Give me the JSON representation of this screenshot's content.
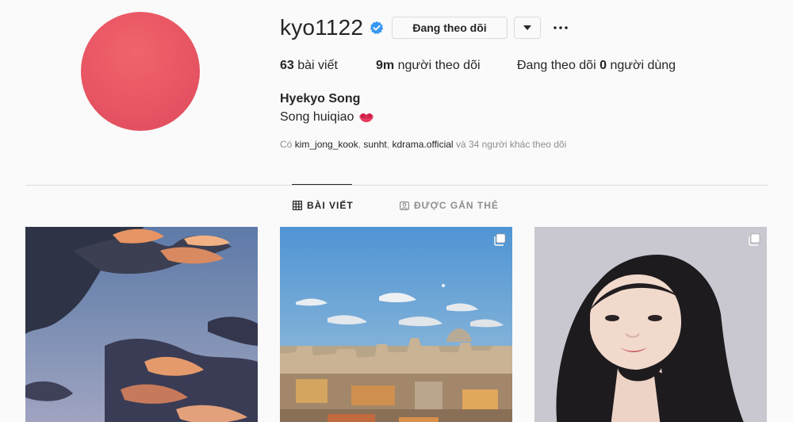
{
  "profile": {
    "username": "kyo1122",
    "follow_button": "Đang theo dõi",
    "stats": {
      "posts_count": "63",
      "posts_label": "bài viết",
      "followers_count": "9m",
      "followers_label": "người theo dõi",
      "following_prefix": "Đang theo dõi",
      "following_count": "0",
      "following_suffix": "người dùng"
    },
    "full_name": "Hyekyo Song",
    "bio": "Song huiqiao",
    "followed_by": {
      "prefix": "Có",
      "accounts": [
        "kim_jong_kook",
        "sunht",
        "kdrama.official"
      ],
      "suffix": "và 34 người khác theo dõi"
    }
  },
  "tabs": {
    "posts": "BÀI VIẾT",
    "tagged": "ĐƯỢC GẮN THẺ"
  },
  "icons": {
    "verified": "verified-badge-icon",
    "dropdown": "chevron-down-icon",
    "more": "more-horizontal-icon",
    "posts_tab": "grid-icon",
    "tagged_tab": "tagged-user-icon",
    "multi_photo": "carousel-icon",
    "bio_emoji": "kiss-mark-emoji"
  },
  "colors": {
    "avatar": "#e85563",
    "verified": "#3897f0",
    "muted_text": "#8e8e8e",
    "border": "#dbdbdb"
  }
}
